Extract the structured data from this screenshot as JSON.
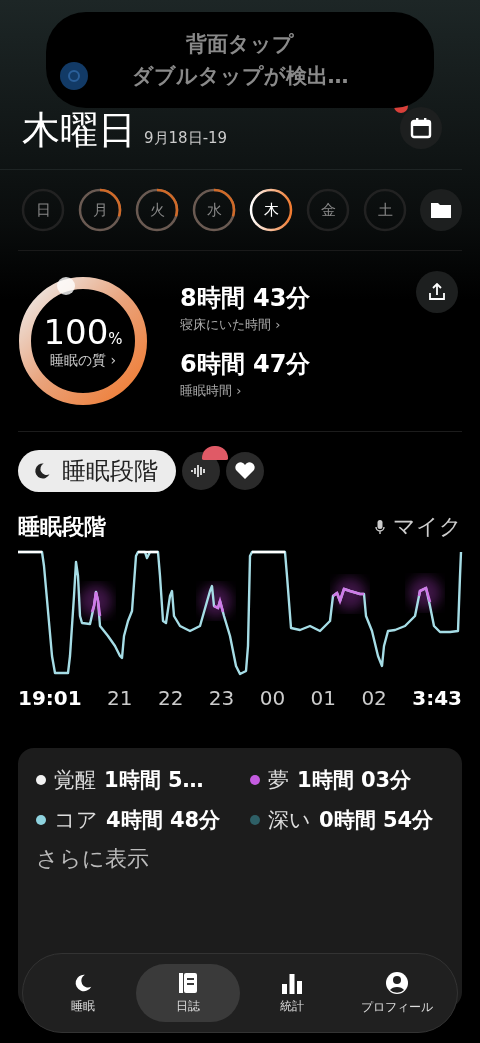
{
  "notification": {
    "title": "背面タップ",
    "body": "ダブルタップが検出…"
  },
  "header": {
    "day": "木曜日",
    "date": "9月18日-19",
    "calendar_badge": true
  },
  "week": [
    {
      "label": "日",
      "recorded": false,
      "selected": false
    },
    {
      "label": "月",
      "recorded": true,
      "selected": false
    },
    {
      "label": "火",
      "recorded": true,
      "selected": false
    },
    {
      "label": "水",
      "recorded": true,
      "selected": false
    },
    {
      "label": "木",
      "recorded": true,
      "selected": true
    },
    {
      "label": "金",
      "recorded": false,
      "selected": false
    },
    {
      "label": "土",
      "recorded": false,
      "selected": false
    }
  ],
  "quality": {
    "value": "100",
    "unit": "%",
    "label": "睡眠の質 ›"
  },
  "stats": [
    {
      "value": "8時間 43分",
      "label": "寝床にいた時間 ›"
    },
    {
      "value": "6時間 47分",
      "label": "睡眠時間 ›"
    }
  ],
  "stage_tab": {
    "label": "睡眠段階"
  },
  "chart": {
    "title": "睡眠段階",
    "source": "マイク",
    "times": [
      "19:01",
      "21",
      "22",
      "23",
      "00",
      "01",
      "02",
      "3:43"
    ]
  },
  "legend": [
    {
      "name": "覚醒",
      "value": "1時間 5…",
      "color": "#f2f2f2"
    },
    {
      "name": "夢",
      "value": "1時間 03分",
      "color": "#c45ce0"
    },
    {
      "name": "コア",
      "value": "4時間 48分",
      "color": "#8fd3df"
    },
    {
      "name": "深い",
      "value": "0時間 54分",
      "color": "#2e5f66"
    }
  ],
  "more": "さらに表示",
  "nav": [
    {
      "label": "睡眠",
      "selected": false
    },
    {
      "label": "日誌",
      "selected": true
    },
    {
      "label": "統計",
      "selected": false
    },
    {
      "label": "プロフィール",
      "selected": false
    }
  ]
}
